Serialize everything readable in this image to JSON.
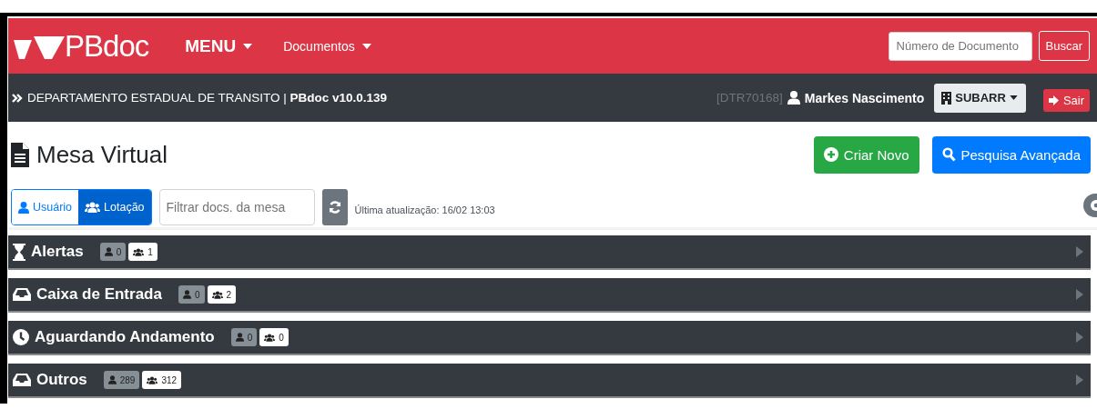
{
  "navbar": {
    "logo": "**PB**doc",
    "menus": [
      {
        "label": "MENU",
        "kind": "main"
      },
      {
        "label": "Documentos",
        "kind": "sub"
      }
    ],
    "search": {
      "placeholder": "Número de Documento",
      "button": "Buscar"
    }
  },
  "infobar": {
    "breadcrumb": "DEPARTAMENTO ESTADUAL DE TRANSITO | **PBdoc v10.0.139**",
    "user_code": "[DTR70168]",
    "user_name": "Markes Nascimento",
    "unit": "SUBARR",
    "logout": "Sair"
  },
  "page": {
    "title": "Mesa Virtual",
    "buttons": [
      {
        "label": "Criar Novo",
        "kind": "create"
      },
      {
        "label": "Pesquisa Avançada",
        "kind": "search"
      }
    ]
  },
  "toolbar": {
    "toggle": [
      {
        "label": "Usuário",
        "kind": "user",
        "selected": false
      },
      {
        "label": "Lotação",
        "kind": "group",
        "selected": true
      }
    ],
    "filter": {
      "placeholder": "Filtrar docs. da mesa"
    },
    "last_update": "Última atualização: 16/02 13:03"
  },
  "sections": [
    {
      "title": "Alertas",
      "kind": "hourglass",
      "user_count": "0",
      "group_count": "1",
      "expanded": false
    },
    {
      "title": "Caixa de Entrada",
      "kind": "inbox",
      "user_count": "0",
      "group_count": "2",
      "expanded": false
    },
    {
      "title": "Aguardando Andamento",
      "kind": "clock",
      "user_count": "0",
      "group_count": "0",
      "expanded": false
    },
    {
      "title": "Outros",
      "kind": "inbox",
      "user_count": "289",
      "group_count": "312",
      "expanded": false
    }
  ]
}
